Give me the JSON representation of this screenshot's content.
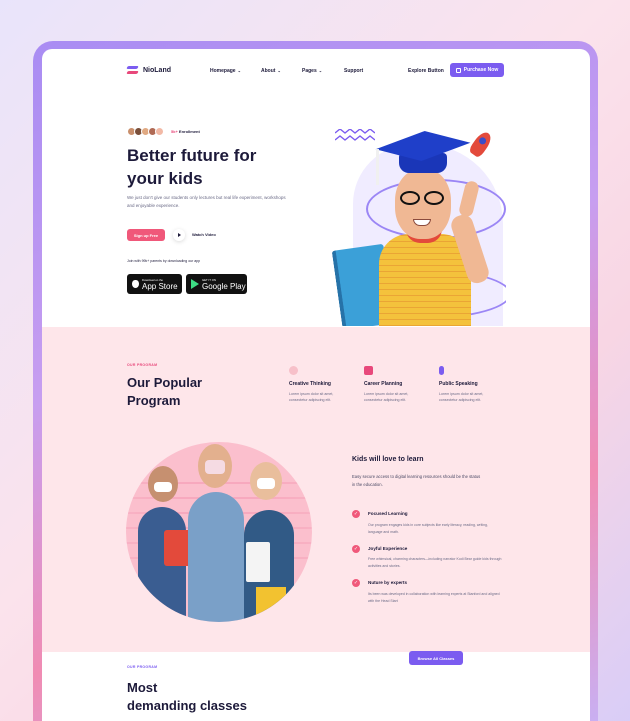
{
  "nav": {
    "logo": "NioLand",
    "menu": [
      {
        "label": "Homepage",
        "chevron": true
      },
      {
        "label": "About",
        "chevron": true
      },
      {
        "label": "Pages",
        "chevron": true
      },
      {
        "label": "Support",
        "chevron": false
      }
    ],
    "explore": "Explore Button",
    "purchase": "Purchase Now"
  },
  "hero": {
    "enroll_count": "5k+",
    "enroll_label": "Enrollment",
    "title_line1": "Better future for",
    "title_line2": "your kids",
    "description": "We just don't give our students only lectures but real life experiment, workshops and enjoyable experience.",
    "signup": "Sign up Free",
    "watch": "Watch Video",
    "joined": "Join with 99k+ parents by downloading our app",
    "appstore_sub": "Download on the",
    "appstore_main": "App Store",
    "googleplay_sub": "GET IT ON",
    "googleplay_main": "Google Play"
  },
  "program": {
    "eyebrow": "OUR PROGRAM",
    "title_line1": "Our Popular",
    "title_line2": "Program",
    "features": [
      {
        "title": "Creative Thinking",
        "text": "Lorem ipsum dolor sit amet, consectetur adipiscing elit.",
        "icon": "palette-icon",
        "color": "#f7c0c9"
      },
      {
        "title": "Career Planning",
        "text": "Lorem ipsum dolor sit amet, consectetur adipiscing elit.",
        "icon": "book-icon",
        "color": "#e8487b"
      },
      {
        "title": "Public Speaking",
        "text": "Lorem ipsum dolor sit amet, consectetur adipiscing elit.",
        "icon": "microphone-icon",
        "color": "#7b5cf0"
      }
    ]
  },
  "learn": {
    "title": "Kids will love to learn",
    "description": "Easy secure access to digital learning resources should be the status in the education.",
    "items": [
      {
        "title": "Focused Learning",
        "text": "Our program engages kids in core subjects like early literacy, reading, writing, language and math."
      },
      {
        "title": "Joyful Experience",
        "text": "Free whimsical, charming characters—including narrator Kodi Bear guide kids through activities and stories."
      },
      {
        "title": "Nuture by experts",
        "text": "Its been was developed in collaboration with learning experts at Stanford and aligned with the Head Start"
      }
    ]
  },
  "classes": {
    "eyebrow": "OUR PROGRAM",
    "title_line1": "Most",
    "title_line2": "demanding classes",
    "browse": "Browse All Classes"
  },
  "colors": {
    "accent_purple": "#7b5cf0",
    "accent_pink": "#e8487b",
    "section_pink": "#fee6ea",
    "heading": "#1d1a3a"
  }
}
